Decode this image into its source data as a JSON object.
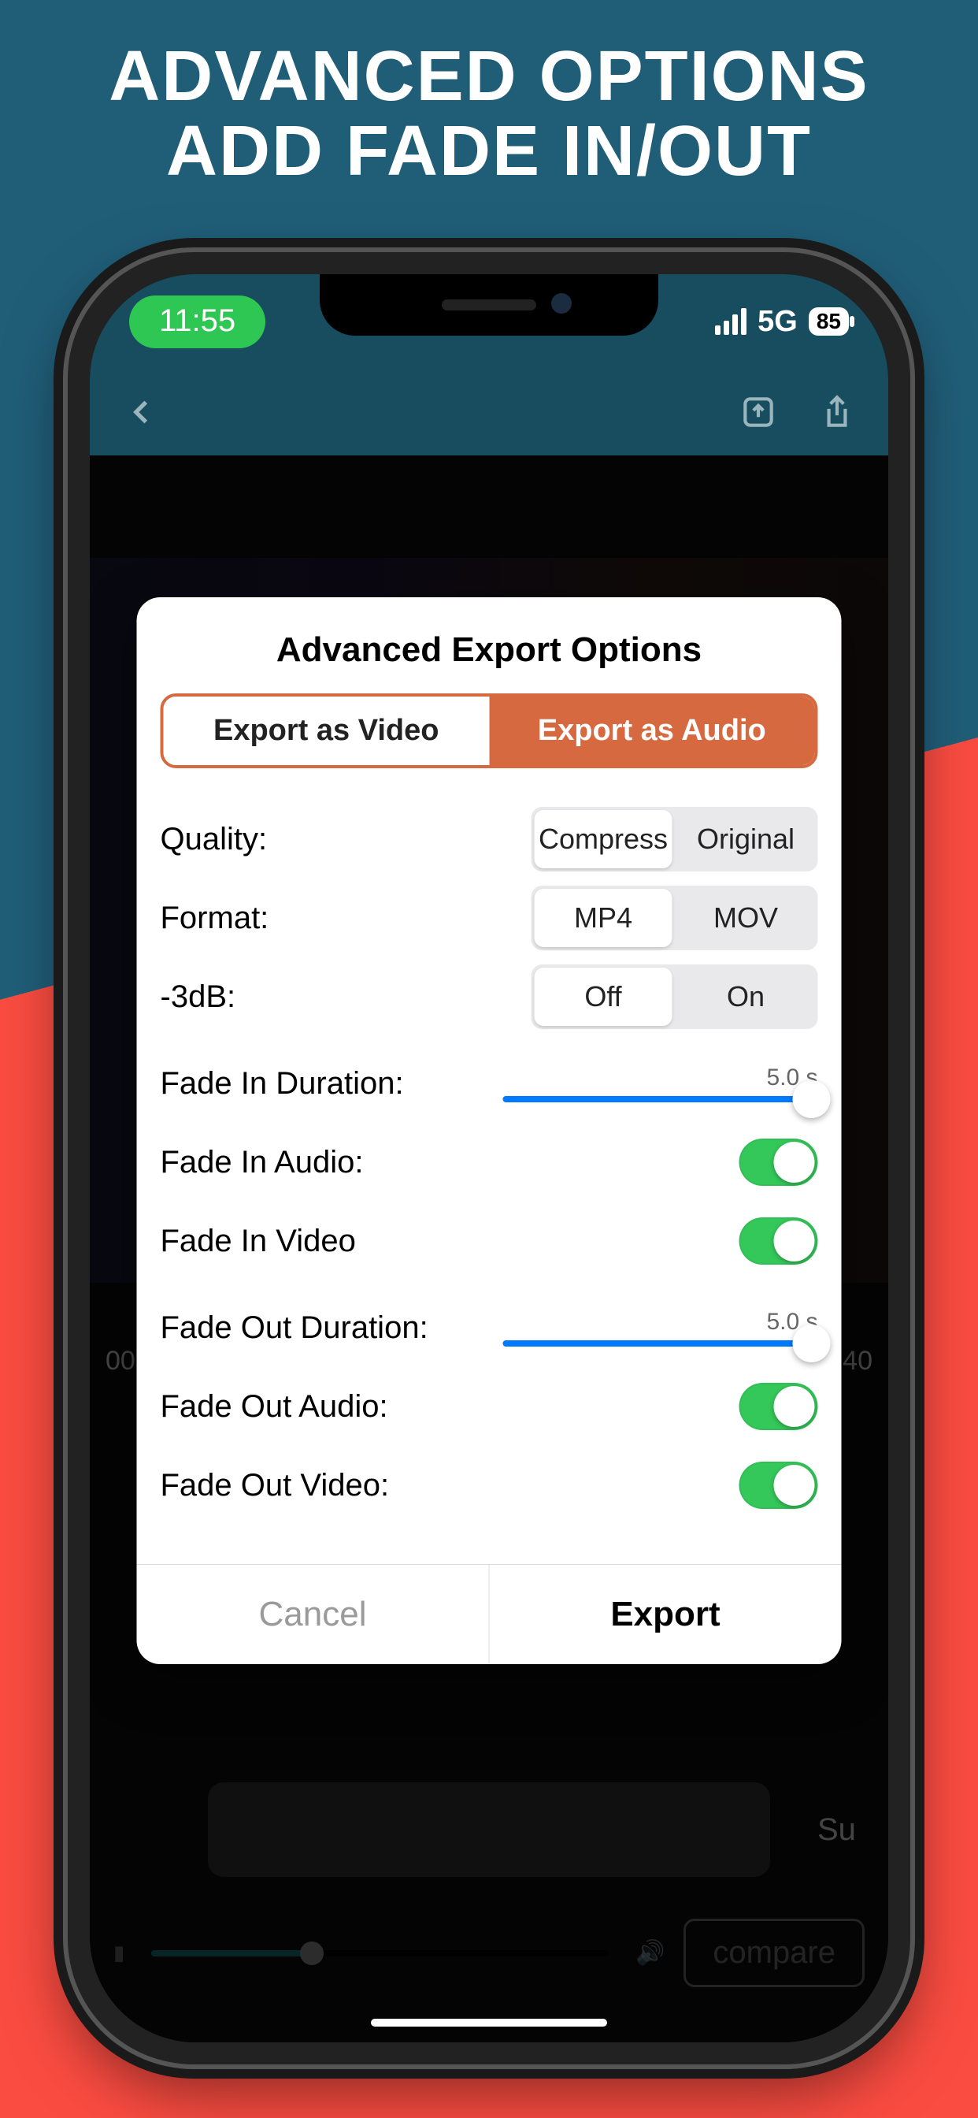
{
  "hero": {
    "line1": "ADVANCED OPTIONS",
    "line2": "ADD FADE IN/OUT"
  },
  "status": {
    "time": "11:55",
    "network": "5G",
    "battery": "85"
  },
  "timeline": {
    "left": "00",
    "right": "40"
  },
  "bottom": {
    "compare": "compare",
    "hidden_label": "Su"
  },
  "modal": {
    "title": "Advanced Export Options",
    "tab_video": "Export as Video",
    "tab_audio": "Export as Audio",
    "quality_label": "Quality:",
    "quality_opts": [
      "Compress",
      "Original"
    ],
    "format_label": "Format:",
    "format_opts": [
      "MP4",
      "MOV"
    ],
    "db_label": "-3dB:",
    "db_opts": [
      "Off",
      "On"
    ],
    "fade_in_dur_label": "Fade In Duration:",
    "fade_in_dur_value": "5.0 s",
    "fade_in_audio_label": "Fade In Audio:",
    "fade_in_video_label": "Fade In Video",
    "fade_out_dur_label": "Fade Out Duration:",
    "fade_out_dur_value": "5.0 s",
    "fade_out_audio_label": "Fade Out Audio:",
    "fade_out_video_label": "Fade Out Video:",
    "cancel": "Cancel",
    "export": "Export"
  }
}
